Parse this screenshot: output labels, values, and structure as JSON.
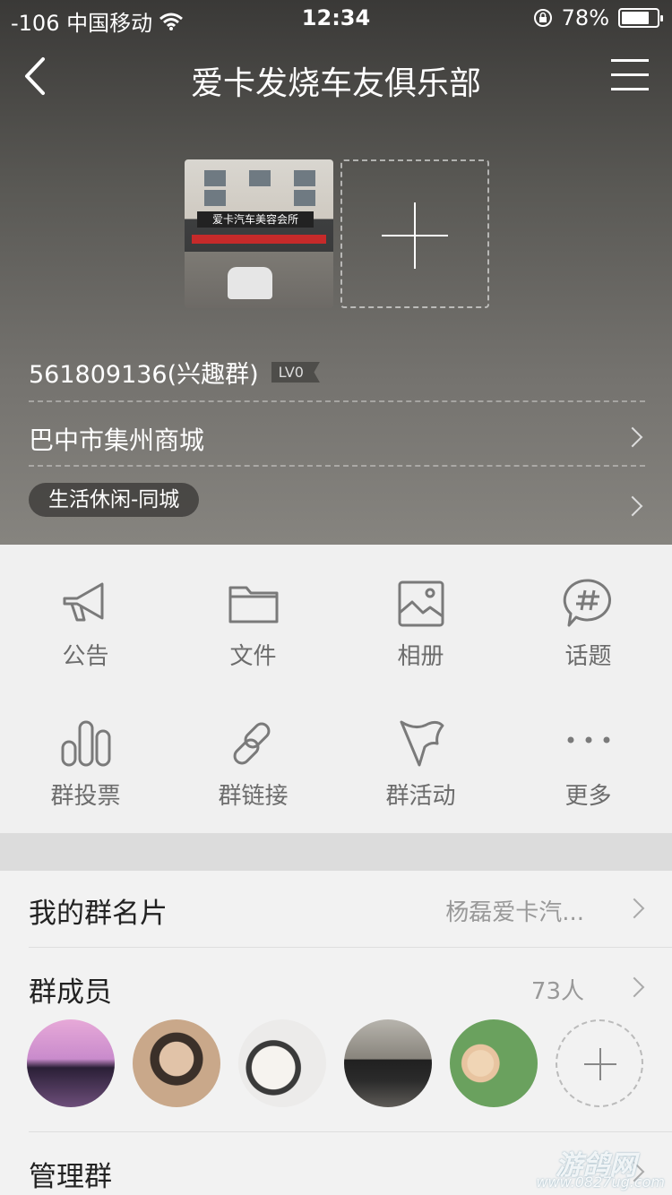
{
  "status_bar": {
    "carrier": "-106 中国移动",
    "time": "12:34",
    "battery": "78%",
    "battery_level": 0.78
  },
  "nav": {
    "title": "爱卡发烧车友俱乐部",
    "back_icon": "chevron-left-icon",
    "menu_icon": "hamburger-menu-icon"
  },
  "group_info": {
    "photo_sign_text": "爱卡汽车美容会所",
    "group_id": "561809136(兴趣群)",
    "level": "LV0",
    "location": "巴中市集州商城",
    "category": "生活休闲-同城"
  },
  "functions": [
    {
      "label": "公告",
      "icon": "megaphone-icon"
    },
    {
      "label": "文件",
      "icon": "folder-icon"
    },
    {
      "label": "相册",
      "icon": "album-icon"
    },
    {
      "label": "话题",
      "icon": "topic-hashtag-icon"
    },
    {
      "label": "群投票",
      "icon": "vote-bars-icon"
    },
    {
      "label": "群链接",
      "icon": "link-icon"
    },
    {
      "label": "群活动",
      "icon": "flag-icon"
    },
    {
      "label": "更多",
      "icon": "more-dots-icon"
    }
  ],
  "list": {
    "card_label": "我的群名片",
    "card_value": "杨磊爱卡汽...",
    "members_label": "群成员",
    "members_count": "73人",
    "manage_label": "管理群"
  },
  "watermark": {
    "text": "游鸽网",
    "url": "www.0827ug.com"
  },
  "colors": {
    "hero_top": "#3a3937",
    "hero_bottom": "#86847f",
    "icon_gray": "#7a7a7a",
    "background": "#f2f2f2"
  }
}
